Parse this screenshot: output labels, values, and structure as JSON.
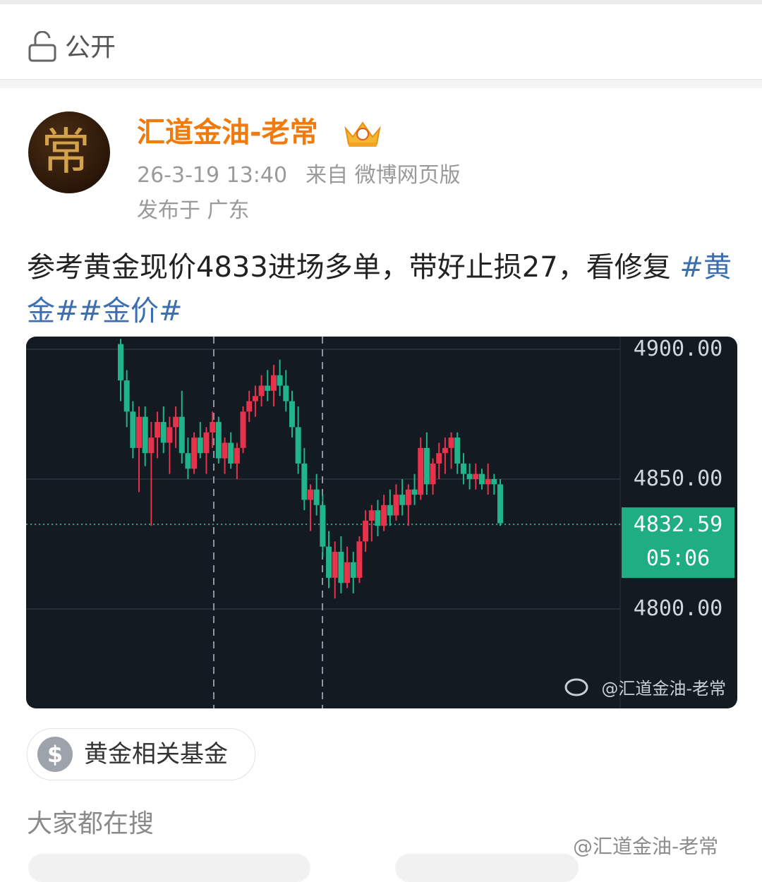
{
  "visibility": {
    "label": "公开",
    "icon": "unlock-icon"
  },
  "author": {
    "name": "汇道金油-老常",
    "avatar_char": "常",
    "badge_icon": "crown-badge-icon"
  },
  "meta": {
    "time": "26-3-19 13:40",
    "source": "来自 微博网页版",
    "location": "发布于 广东"
  },
  "post": {
    "text": "参考黄金现价4833进场多单，带好止损27，看修复",
    "tags": [
      "#黄金#",
      "#金价#"
    ]
  },
  "chart_data": {
    "type": "candlestick",
    "y_tick_labels": [
      "4900.00",
      "4850.00",
      "4800.00"
    ],
    "y_ticks": [
      4900,
      4850,
      4800
    ],
    "ylim": [
      4765,
      4905
    ],
    "current_price_label": "4832.59",
    "current_price": 4832.59,
    "countdown": "05:06",
    "watermark": "@汇道金油-老常",
    "colors": {
      "up": "#e8314a",
      "down": "#1fb48a",
      "bg": "#141a21",
      "price_tag": "#1fae84"
    },
    "candles": [
      [
        4902,
        4904,
        4880,
        4888
      ],
      [
        4888,
        4892,
        4870,
        4876
      ],
      [
        4876,
        4880,
        4858,
        4862
      ],
      [
        4862,
        4878,
        4845,
        4874
      ],
      [
        4874,
        4878,
        4855,
        4860
      ],
      [
        4860,
        4872,
        4832,
        4866
      ],
      [
        4866,
        4876,
        4858,
        4872
      ],
      [
        4872,
        4878,
        4860,
        4864
      ],
      [
        4864,
        4874,
        4852,
        4870
      ],
      [
        4870,
        4878,
        4862,
        4874
      ],
      [
        4874,
        4884,
        4856,
        4860
      ],
      [
        4860,
        4866,
        4850,
        4854
      ],
      [
        4854,
        4868,
        4852,
        4866
      ],
      [
        4866,
        4872,
        4858,
        4860
      ],
      [
        4860,
        4870,
        4852,
        4868
      ],
      [
        4868,
        4876,
        4862,
        4872
      ],
      [
        4872,
        4874,
        4856,
        4858
      ],
      [
        4858,
        4866,
        4852,
        4864
      ],
      [
        4864,
        4868,
        4854,
        4856
      ],
      [
        4856,
        4864,
        4850,
        4862
      ],
      [
        4862,
        4878,
        4860,
        4876
      ],
      [
        4876,
        4884,
        4872,
        4880
      ],
      [
        4880,
        4886,
        4874,
        4882
      ],
      [
        4882,
        4890,
        4878,
        4886
      ],
      [
        4886,
        4892,
        4880,
        4884
      ],
      [
        4884,
        4894,
        4878,
        4890
      ],
      [
        4890,
        4896,
        4882,
        4886
      ],
      [
        4886,
        4892,
        4876,
        4880
      ],
      [
        4880,
        4884,
        4866,
        4870
      ],
      [
        4870,
        4878,
        4852,
        4856
      ],
      [
        4856,
        4862,
        4838,
        4842
      ],
      [
        4842,
        4848,
        4830,
        4846
      ],
      [
        4846,
        4852,
        4836,
        4840
      ],
      [
        4840,
        4844,
        4820,
        4824
      ],
      [
        4824,
        4830,
        4808,
        4812
      ],
      [
        4812,
        4826,
        4804,
        4822
      ],
      [
        4822,
        4828,
        4806,
        4810
      ],
      [
        4810,
        4824,
        4808,
        4818
      ],
      [
        4818,
        4822,
        4806,
        4812
      ],
      [
        4812,
        4828,
        4810,
        4826
      ],
      [
        4826,
        4838,
        4822,
        4834
      ],
      [
        4834,
        4840,
        4826,
        4838
      ],
      [
        4838,
        4842,
        4828,
        4832
      ],
      [
        4832,
        4844,
        4830,
        4840
      ],
      [
        4840,
        4846,
        4832,
        4836
      ],
      [
        4836,
        4848,
        4834,
        4844
      ],
      [
        4844,
        4850,
        4836,
        4840
      ],
      [
        4840,
        4848,
        4832,
        4846
      ],
      [
        4846,
        4852,
        4840,
        4844
      ],
      [
        4844,
        4866,
        4842,
        4862
      ],
      [
        4862,
        4868,
        4844,
        4848
      ],
      [
        4848,
        4858,
        4844,
        4856
      ],
      [
        4856,
        4864,
        4850,
        4860
      ],
      [
        4860,
        4866,
        4852,
        4862
      ],
      [
        4862,
        4868,
        4854,
        4866
      ],
      [
        4866,
        4868,
        4852,
        4856
      ],
      [
        4856,
        4860,
        4848,
        4852
      ],
      [
        4852,
        4856,
        4846,
        4850
      ],
      [
        4850,
        4856,
        4846,
        4852
      ],
      [
        4852,
        4854,
        4846,
        4848
      ],
      [
        4848,
        4856,
        4844,
        4850
      ],
      [
        4850,
        4852,
        4844,
        4848
      ],
      [
        4848,
        4850,
        4832,
        4833
      ]
    ]
  },
  "fund": {
    "label": "黄金相关基金",
    "icon_char": "$"
  },
  "search_heading": "大家都在搜",
  "page_watermark": "@汇道金油-老常"
}
